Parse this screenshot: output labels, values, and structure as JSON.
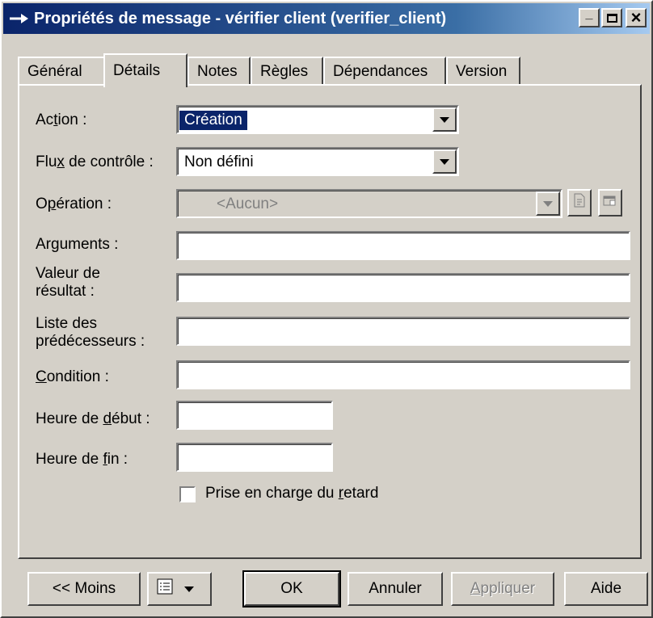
{
  "window": {
    "title": "Propriétés de message - vérifier client (verifier_client)",
    "controls": {
      "minimize": "_",
      "maximize": "□",
      "close": "×"
    }
  },
  "tabs": [
    {
      "label": "Général"
    },
    {
      "label": "Détails",
      "active": true
    },
    {
      "label": "Notes"
    },
    {
      "label": "Règles"
    },
    {
      "label": "Dépendances"
    },
    {
      "label": "Version"
    }
  ],
  "form": {
    "action": {
      "label_pre": "Ac",
      "label_key": "t",
      "label_post": "ion :",
      "value": "Création"
    },
    "control_flow": {
      "label_pre": "Flu",
      "label_key": "x",
      "label_post": " de contrôle :",
      "value": "Non défini"
    },
    "operation": {
      "label_pre": "O",
      "label_key": "p",
      "label_post": "ération :",
      "value": "<Aucun>"
    },
    "arguments": {
      "label": "Arguments :",
      "value": ""
    },
    "return_value": {
      "label_line1": "Valeur de",
      "label_line2": "résultat :",
      "value": ""
    },
    "predecessors": {
      "label_line1": "Liste des",
      "label_line2": "prédécesseurs :",
      "value": ""
    },
    "condition": {
      "label_key": "C",
      "label_post": "ondition :",
      "value": ""
    },
    "begin_time": {
      "label_pre": "Heure de ",
      "label_key": "d",
      "label_post": "ébut :",
      "value": ""
    },
    "end_time": {
      "label_pre": "Heure de ",
      "label_key": "f",
      "label_post": "in :",
      "value": ""
    },
    "delay": {
      "label_pre": "Prise en charge du ",
      "label_key": "r",
      "label_post": "etard",
      "checked": false
    }
  },
  "buttons": {
    "less": "<< Moins",
    "ok": "OK",
    "cancel": "Annuler",
    "apply_key": "A",
    "apply_post": "ppliquer",
    "help": "Aide"
  },
  "icons": {
    "title": "arrow-right-icon",
    "dropdown": "triangle-down-icon",
    "create_operation": "new-document-icon",
    "properties": "properties-icon",
    "menu": "list-menu-icon"
  }
}
